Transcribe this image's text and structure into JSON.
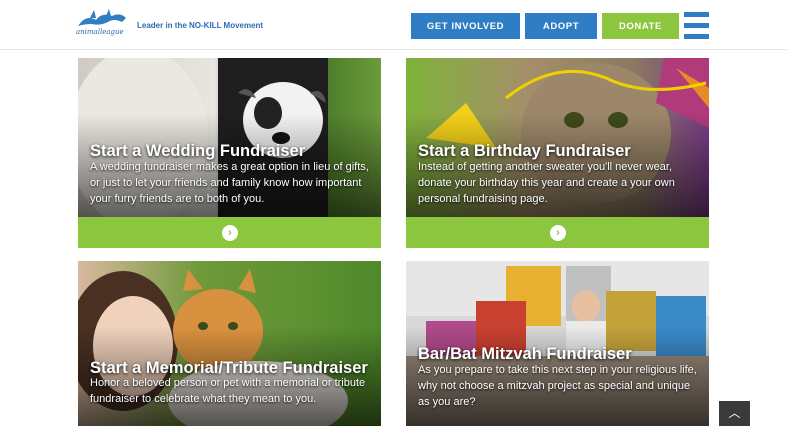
{
  "header": {
    "logo_text": "animalleague",
    "tagline": "Leader in the NO-KILL Movement",
    "nav": {
      "get_involved": "GET INVOLVED",
      "adopt": "ADOPT",
      "donate": "DONATE"
    }
  },
  "cards": [
    {
      "title": "Start a Wedding Fundraiser",
      "description": "A wedding fundraiser makes a great option in lieu of gifts, or just to let your friends and family know how important your furry friends are to both of you."
    },
    {
      "title": "Start a Birthday Fundraiser",
      "description": "Instead of getting another sweater you'll never wear, donate your birthday this year and create a your own personal fundraising page."
    },
    {
      "title": "Start a Memorial/Tribute Fundraiser",
      "description": "Honor a beloved person or pet with a memorial or tribute fundraiser to celebrate what they mean to you."
    },
    {
      "title": "Bar/Bat Mitzvah Fundraiser",
      "description": "As you prepare to take this next step in your religious life, why not choose a mitzvah project as special and unique as you are?"
    }
  ],
  "colors": {
    "primary_blue": "#2f7ec4",
    "accent_green": "#8cc63f"
  },
  "icons": {
    "card_arrow": "chevron-right-circle-icon",
    "scroll_top": "chevron-up-icon",
    "menu": "hamburger-menu-icon"
  }
}
